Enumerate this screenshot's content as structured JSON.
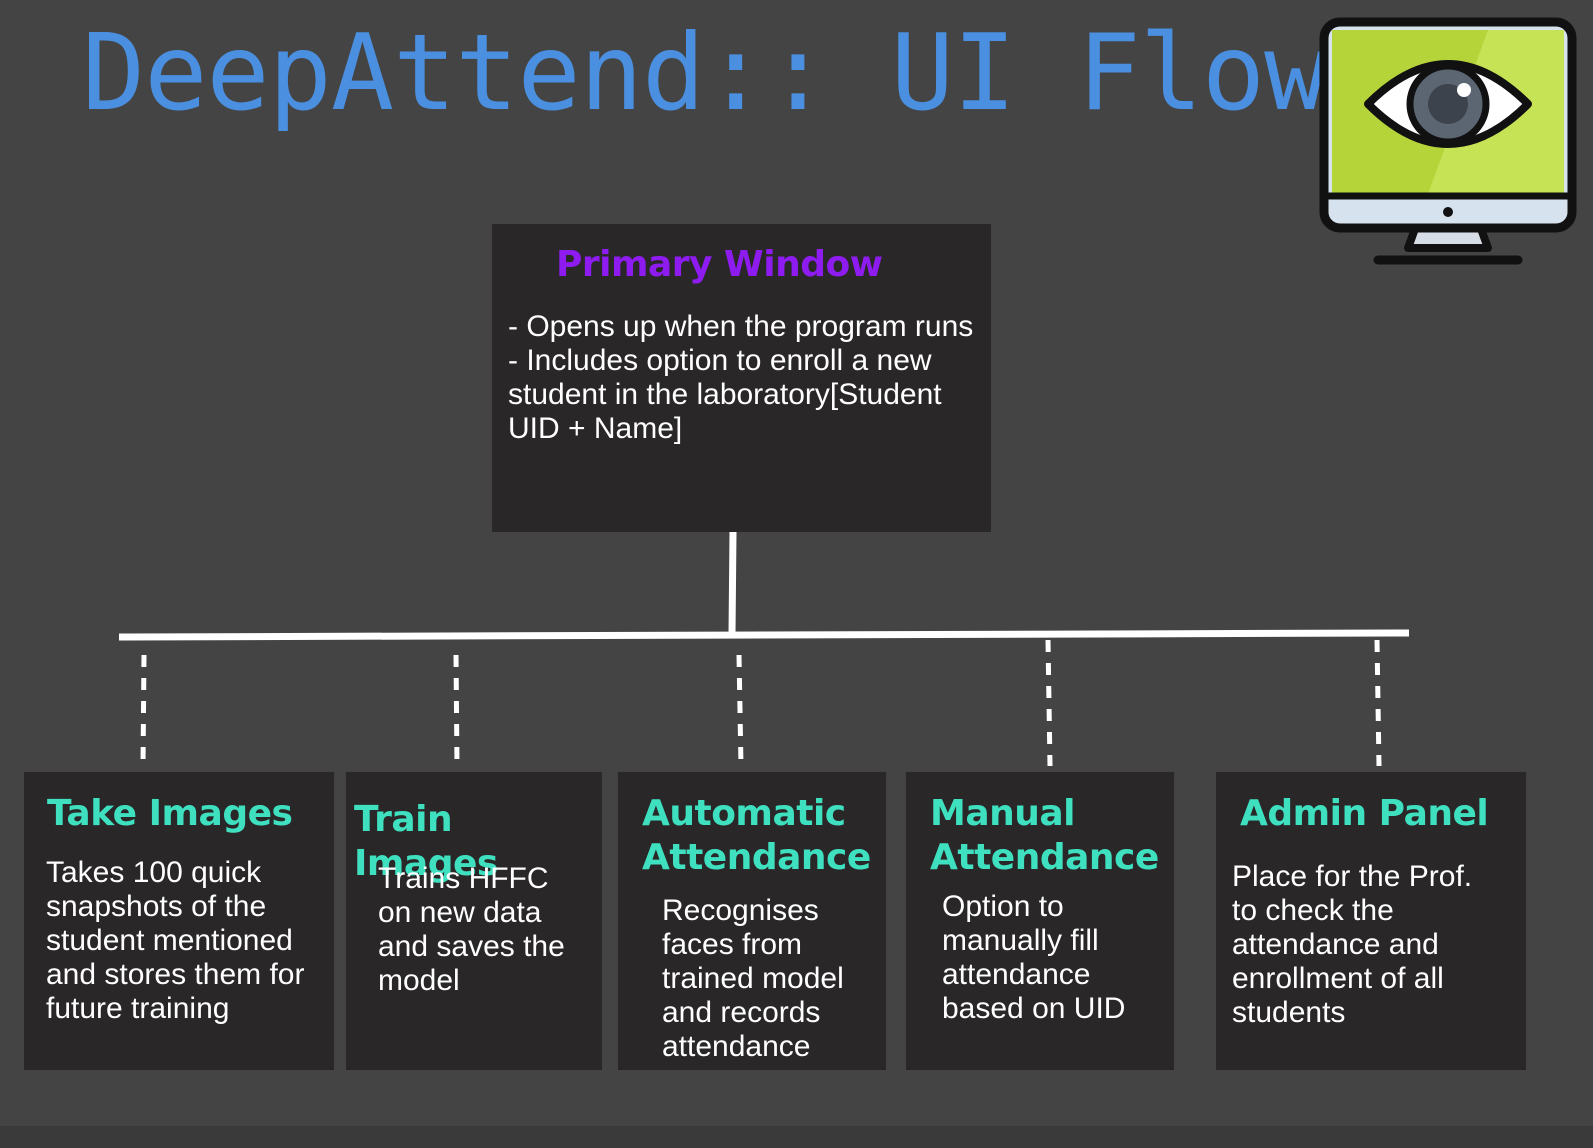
{
  "title": "DeepAttend:: UI Flow",
  "monitor_icon": {
    "icon": "monitor-eye-icon",
    "screen_color": "#b4d43a",
    "outline_color": "#111111"
  },
  "colors": {
    "background": "#444444",
    "title": "#4a8fe0",
    "box": "#292727",
    "primary_heading": "#8e1cf0",
    "child_heading": "#3ee0c0",
    "connector": "#ffffff"
  },
  "primary": {
    "title": "Primary Window",
    "lines": [
      "- Opens up when the program runs",
      "- Includes option to enroll a new student in the laboratory[Student UID + Name]"
    ]
  },
  "children": [
    {
      "title": "Take Images",
      "description": "Takes 100 quick snapshots of the student mentioned and stores them for future training"
    },
    {
      "title": "Train Images",
      "description": "Trains HFFC on new data and saves the model"
    },
    {
      "title": "Automatic Attendance",
      "description": "Recognises faces from trained model and records attendance"
    },
    {
      "title": "Manual Attendance",
      "description": "Option to manually fill attendance based on UID"
    },
    {
      "title": "Admin Panel",
      "description": "Place for the Prof. to check the attendance and enrollment of all students"
    }
  ]
}
